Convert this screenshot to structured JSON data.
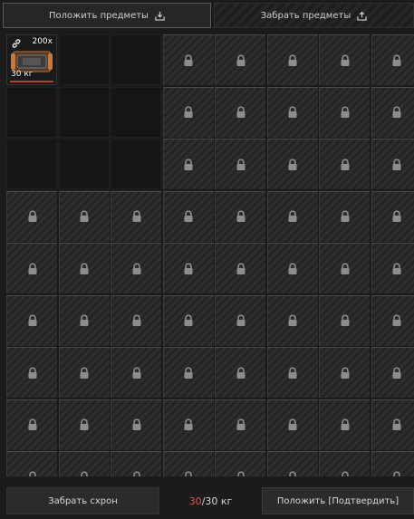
{
  "tabs": {
    "put_items": "Положить предметы",
    "take_items": "Забрать предметы"
  },
  "grid": {
    "columns": 8,
    "rows": 9,
    "open_cells": [
      0,
      1,
      2,
      8,
      9,
      10,
      16,
      17,
      18
    ]
  },
  "item": {
    "quantity": "200x",
    "weight": "30 кг",
    "link_icon": "link-icon"
  },
  "footer": {
    "take_stash": "Забрать схрон",
    "capacity_used": "30",
    "capacity_rest": "/30 кг",
    "confirm_put": "Положить [Подтвердить]"
  },
  "colors": {
    "capacity_used": "#e0544a",
    "item_bar": "#c0392b"
  }
}
